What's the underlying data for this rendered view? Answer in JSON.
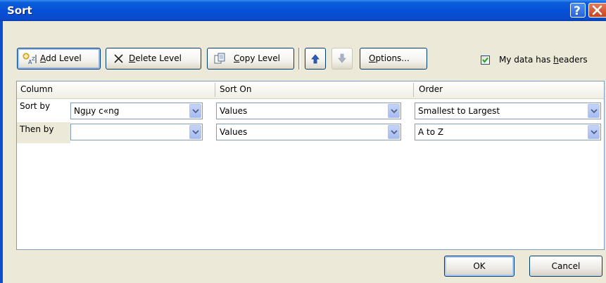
{
  "window": {
    "title": "Sort"
  },
  "titlebar": {
    "help_label": "?",
    "close_icon": "close-icon"
  },
  "toolbar": {
    "add_level": {
      "pre": "",
      "accel": "A",
      "post": "dd Level"
    },
    "delete_level": {
      "pre": "",
      "accel": "D",
      "post": "elete Level"
    },
    "copy_level": {
      "pre": "",
      "accel": "C",
      "post": "opy Level"
    },
    "move_up_icon": "arrow-up-icon",
    "move_down_icon": "arrow-down-icon",
    "options": {
      "pre": "",
      "accel": "O",
      "post": "ptions..."
    },
    "headers_checkbox": {
      "checked": true,
      "pre": "My data has ",
      "accel": "h",
      "post": "eaders"
    }
  },
  "grid": {
    "headers": {
      "column": "Column",
      "sort_on": "Sort On",
      "order": "Order"
    },
    "rows": [
      {
        "label": "Sort by",
        "column": "Ngµy c«ng",
        "sort_on": "Values",
        "order": "Smallest to Largest"
      },
      {
        "label": "Then by",
        "column": "",
        "sort_on": "Values",
        "order": "A to Z"
      }
    ]
  },
  "buttons": {
    "ok": "OK",
    "cancel": "Cancel"
  },
  "colors": {
    "titlebar": "#0550D6",
    "dialog_bg": "#ECE9D8",
    "check": "#21A121"
  }
}
